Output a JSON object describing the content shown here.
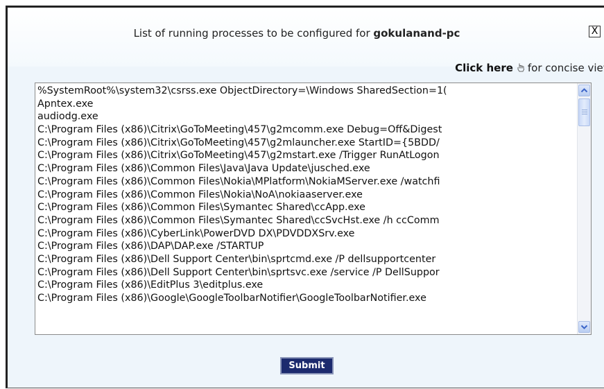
{
  "dialog": {
    "title_prefix": "List of running processes to be configured for ",
    "title_host": "gokulanand-pc",
    "close_label": "X",
    "concise_link": "Click here",
    "concise_suffix": "for concise view",
    "submit_label": "Submit"
  },
  "icons": {
    "close": "close-icon",
    "hand": "hand-pointer-icon",
    "scroll_up": "arrow-up-icon",
    "scroll_down": "arrow-down-icon"
  },
  "colors": {
    "submit_bg": "#1c2a6e",
    "dialog_bg": "#eef5fb",
    "scroll_accent": "#3b64c8"
  },
  "processes": [
    "%SystemRoot%\\system32\\csrss.exe ObjectDirectory=\\Windows SharedSection=1(",
    "Apntex.exe",
    "audiodg.exe",
    "C:\\Program Files (x86)\\Citrix\\GoToMeeting\\457\\g2mcomm.exe Debug=Off&Digest",
    "C:\\Program Files (x86)\\Citrix\\GoToMeeting\\457\\g2mlauncher.exe StartID={5BDD/",
    "C:\\Program Files (x86)\\Citrix\\GoToMeeting\\457\\g2mstart.exe /Trigger RunAtLogon",
    "C:\\Program Files (x86)\\Common Files\\Java\\Java Update\\jusched.exe",
    "C:\\Program Files (x86)\\Common Files\\Nokia\\MPlatform\\NokiaMServer.exe /watchfi",
    "C:\\Program Files (x86)\\Common Files\\Nokia\\NoA\\nokiaaserver.exe",
    "C:\\Program Files (x86)\\Common Files\\Symantec Shared\\ccApp.exe",
    "C:\\Program Files (x86)\\Common Files\\Symantec Shared\\ccSvcHst.exe /h ccComm",
    "C:\\Program Files (x86)\\CyberLink\\PowerDVD DX\\PDVDDXSrv.exe",
    "C:\\Program Files (x86)\\DAP\\DAP.exe /STARTUP",
    "C:\\Program Files (x86)\\Dell Support Center\\bin\\sprtcmd.exe /P dellsupportcenter",
    "C:\\Program Files (x86)\\Dell Support Center\\bin\\sprtsvc.exe /service /P DellSuppor",
    "C:\\Program Files (x86)\\EditPlus 3\\editplus.exe",
    "C:\\Program Files (x86)\\Google\\GoogleToolbarNotifier\\GoogleToolbarNotifier.exe"
  ]
}
